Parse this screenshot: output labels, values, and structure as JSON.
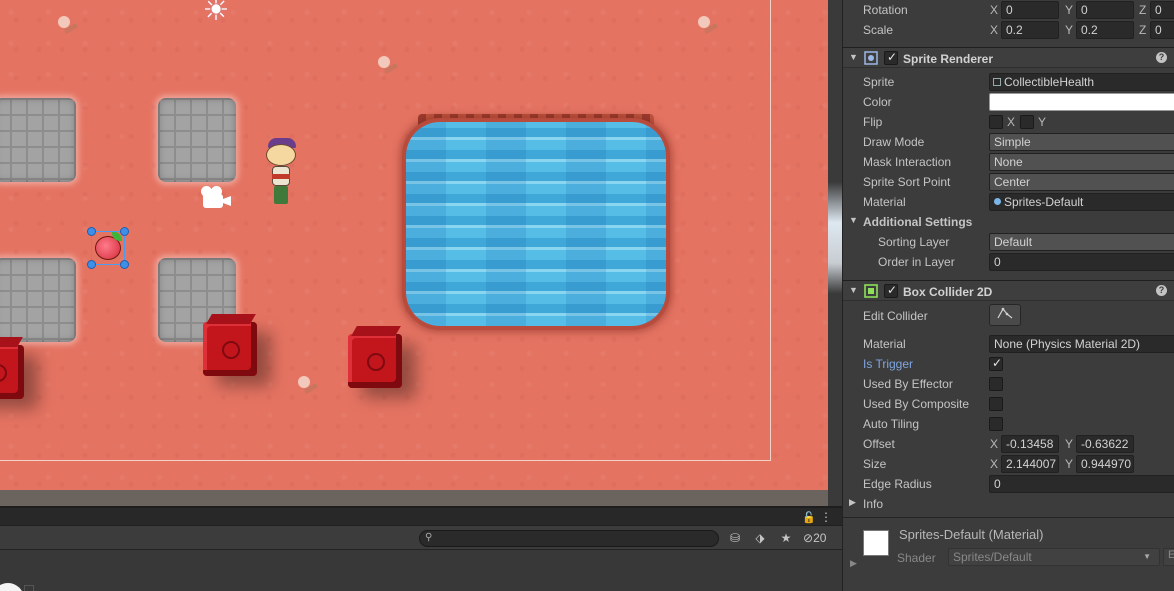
{
  "scene": {
    "icons": {
      "sun": "sun-icon",
      "camera": "camera-gizmo-icon"
    }
  },
  "bottom_panel": {
    "search": {
      "value": "",
      "placeholder": ""
    },
    "lock_icon": "🔓",
    "kebab_icon": "⋮",
    "hidden_count": "20"
  },
  "inspector": {
    "transform": {
      "rotation_label": "Rotation",
      "rotation": {
        "x_label": "X",
        "x": "0",
        "y_label": "Y",
        "y": "0",
        "z_label": "Z",
        "z": "0"
      },
      "scale_label": "Scale",
      "scale": {
        "x_label": "X",
        "x": "0.2",
        "y_label": "Y",
        "y": "0.2",
        "z_label": "Z",
        "z": "0"
      }
    },
    "sprite_renderer": {
      "title": "Sprite Renderer",
      "sprite_label": "Sprite",
      "sprite_value": "CollectibleHealth",
      "color_label": "Color",
      "color_value": "#ffffff",
      "flip_label": "Flip",
      "flip_x_label": "X",
      "flip_y_label": "Y",
      "draw_mode_label": "Draw Mode",
      "draw_mode_value": "Simple",
      "mask_interaction_label": "Mask Interaction",
      "mask_interaction_value": "None",
      "sort_point_label": "Sprite Sort Point",
      "sort_point_value": "Center",
      "material_label": "Material",
      "material_value": "Sprites-Default",
      "additional_settings_label": "Additional Settings",
      "sorting_layer_label": "Sorting Layer",
      "sorting_layer_value": "Default",
      "order_in_layer_label": "Order in Layer",
      "order_in_layer_value": "0"
    },
    "box_collider": {
      "title": "Box Collider 2D",
      "edit_collider_label": "Edit Collider",
      "material_label": "Material",
      "material_value": "None (Physics Material 2D)",
      "is_trigger_label": "Is Trigger",
      "is_trigger": true,
      "used_by_effector_label": "Used By Effector",
      "used_by_effector": false,
      "used_by_composite_label": "Used By Composite",
      "used_by_composite": false,
      "auto_tiling_label": "Auto Tiling",
      "auto_tiling": false,
      "offset_label": "Offset",
      "offset": {
        "x_label": "X",
        "x": "-0.13458",
        "y_label": "Y",
        "y": "-0.63622"
      },
      "size_label": "Size",
      "size": {
        "x_label": "X",
        "x": "2.144007",
        "y_label": "Y",
        "y": "0.944970"
      },
      "edge_radius_label": "Edge Radius",
      "edge_radius_value": "0",
      "info_label": "Info"
    },
    "material_preview": {
      "title": "Sprites-Default (Material)",
      "shader_label": "Shader",
      "shader_value": "Sprites/Default",
      "edit_label": "E"
    }
  }
}
